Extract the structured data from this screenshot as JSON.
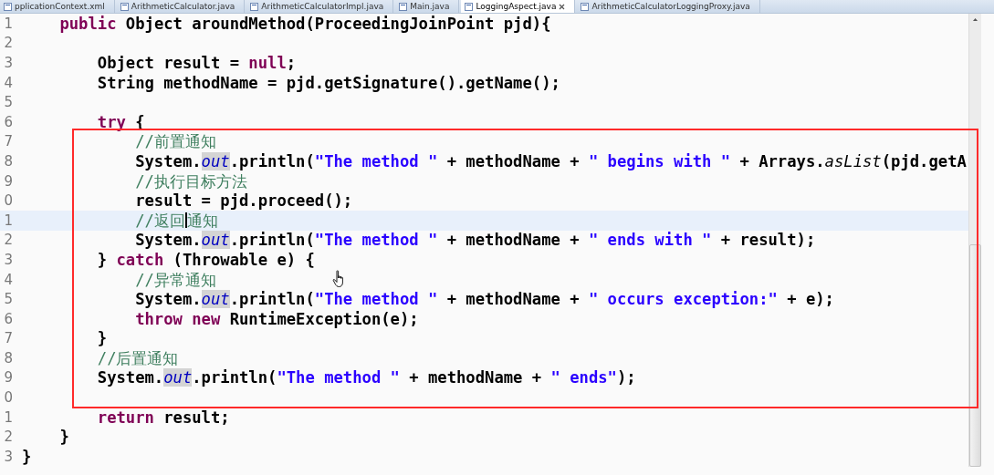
{
  "tabs": [
    {
      "label": "pplicationContext.xml",
      "selected": false
    },
    {
      "label": "ArithmeticCalculator.java",
      "selected": false
    },
    {
      "label": "ArithmeticCalculatorImpl.java",
      "selected": false
    },
    {
      "label": "Main.java",
      "selected": false
    },
    {
      "label": "LoggingAspect.java",
      "selected": true
    },
    {
      "label": "ArithmeticCalculatorLoggingProxy.java",
      "selected": false
    }
  ],
  "editor": {
    "lines": [
      {
        "number": "1",
        "current": false,
        "tokens": [
          {
            "kind": "keyword",
            "text": "    public"
          },
          {
            "kind": "plain",
            "text": " Object aroundMethod(ProceedingJoinPoint pjd){"
          }
        ]
      },
      {
        "number": "2",
        "current": false
      },
      {
        "number": "3",
        "current": false,
        "tokens": [
          {
            "kind": "plain",
            "text": "        Object result = "
          },
          {
            "kind": "keyword",
            "text": "null"
          },
          {
            "kind": "plain",
            "text": ";"
          }
        ]
      },
      {
        "number": "4",
        "current": false,
        "tokens": [
          {
            "kind": "plain",
            "text": "        String methodName = pjd.getSignature().getName();"
          }
        ]
      },
      {
        "number": "5",
        "current": false
      },
      {
        "number": "6",
        "current": false,
        "tokens": [
          {
            "kind": "keyword",
            "text": "        try"
          },
          {
            "kind": "plain",
            "text": " {"
          }
        ]
      },
      {
        "number": "7",
        "current": false,
        "tokens": [
          {
            "kind": "comment",
            "text": "            //前置通知"
          }
        ]
      },
      {
        "number": "8",
        "current": false,
        "tokens": [
          {
            "kind": "plain",
            "text": "            System."
          },
          {
            "kind": "field",
            "text": "out"
          },
          {
            "kind": "plain",
            "text": ".println("
          },
          {
            "kind": "string",
            "text": "\"The method \""
          },
          {
            "kind": "plain",
            "text": " + methodName + "
          },
          {
            "kind": "string",
            "text": "\" begins with \""
          },
          {
            "kind": "plain",
            "text": " + Arrays."
          },
          {
            "kind": "static",
            "text": "asList"
          },
          {
            "kind": "plain",
            "text": "(pjd.getA"
          }
        ]
      },
      {
        "number": "9",
        "current": false,
        "tokens": [
          {
            "kind": "comment",
            "text": "            //执行目标方法"
          }
        ]
      },
      {
        "number": "0",
        "current": false,
        "tokens": [
          {
            "kind": "plain",
            "text": "            result = pjd.proceed();"
          }
        ]
      },
      {
        "number": "1",
        "current": true,
        "tokens": [
          {
            "kind": "comment",
            "text": "            //返回"
          },
          {
            "kind": "caret"
          },
          {
            "kind": "comment",
            "text": "通知"
          }
        ]
      },
      {
        "number": "2",
        "current": false,
        "tokens": [
          {
            "kind": "plain",
            "text": "            System."
          },
          {
            "kind": "field",
            "text": "out"
          },
          {
            "kind": "plain",
            "text": ".println("
          },
          {
            "kind": "string",
            "text": "\"The method \""
          },
          {
            "kind": "plain",
            "text": " + methodName + "
          },
          {
            "kind": "string",
            "text": "\" ends with \""
          },
          {
            "kind": "plain",
            "text": " + result);"
          }
        ]
      },
      {
        "number": "3",
        "current": false,
        "tokens": [
          {
            "kind": "plain",
            "text": "        } "
          },
          {
            "kind": "keyword",
            "text": "catch"
          },
          {
            "kind": "plain",
            "text": " (Throwable e) {"
          }
        ]
      },
      {
        "number": "4",
        "current": false,
        "tokens": [
          {
            "kind": "comment",
            "text": "            //异常通知"
          }
        ]
      },
      {
        "number": "5",
        "current": false,
        "tokens": [
          {
            "kind": "plain",
            "text": "            System."
          },
          {
            "kind": "field",
            "text": "out"
          },
          {
            "kind": "plain",
            "text": ".println("
          },
          {
            "kind": "string",
            "text": "\"The method \""
          },
          {
            "kind": "plain",
            "text": " + methodName + "
          },
          {
            "kind": "string",
            "text": "\" occurs exception:\""
          },
          {
            "kind": "plain",
            "text": " + e);"
          }
        ]
      },
      {
        "number": "6",
        "current": false,
        "tokens": [
          {
            "kind": "keyword",
            "text": "            throw new"
          },
          {
            "kind": "plain",
            "text": " RuntimeException(e);"
          }
        ]
      },
      {
        "number": "7",
        "current": false,
        "tokens": [
          {
            "kind": "plain",
            "text": "        }"
          }
        ]
      },
      {
        "number": "8",
        "current": false,
        "tokens": [
          {
            "kind": "comment",
            "text": "        //后置通知"
          }
        ]
      },
      {
        "number": "9",
        "current": false,
        "tokens": [
          {
            "kind": "plain",
            "text": "        System."
          },
          {
            "kind": "field",
            "text": "out"
          },
          {
            "kind": "plain",
            "text": ".println("
          },
          {
            "kind": "string",
            "text": "\"The method \""
          },
          {
            "kind": "plain",
            "text": " + methodName + "
          },
          {
            "kind": "string",
            "text": "\" ends\""
          },
          {
            "kind": "plain",
            "text": ");"
          }
        ]
      },
      {
        "number": "0",
        "current": false
      },
      {
        "number": "1",
        "current": false,
        "tokens": [
          {
            "kind": "keyword",
            "text": "        return"
          },
          {
            "kind": "plain",
            "text": " result;"
          }
        ]
      },
      {
        "number": "2",
        "current": false,
        "tokens": [
          {
            "kind": "plain",
            "text": "    }"
          }
        ]
      },
      {
        "number": "3",
        "current": false,
        "tokens": [
          {
            "kind": "plain",
            "text": "}"
          }
        ]
      }
    ]
  }
}
